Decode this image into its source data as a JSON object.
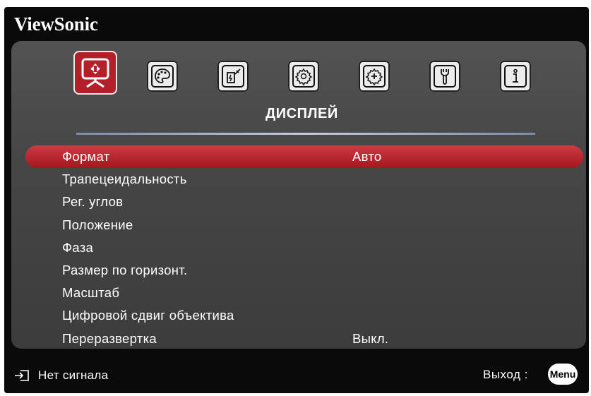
{
  "brand": "ViewSonic",
  "tabs": [
    {
      "name": "display",
      "icon": "display-icon",
      "active": true
    },
    {
      "name": "picture",
      "icon": "palette-icon",
      "active": false
    },
    {
      "name": "power",
      "icon": "power-management-icon",
      "active": false
    },
    {
      "name": "basic",
      "icon": "gear-icon",
      "active": false
    },
    {
      "name": "advanced",
      "icon": "gear-plus-icon",
      "active": false
    },
    {
      "name": "system",
      "icon": "wrench-icon",
      "active": false
    },
    {
      "name": "info",
      "icon": "info-icon",
      "active": false
    }
  ],
  "section_title": "ДИСПЛЕЙ",
  "menu": {
    "items": [
      {
        "label": "Формат",
        "value": "Авто"
      },
      {
        "label": "Трапецеидальность",
        "value": ""
      },
      {
        "label": "Рег. углов",
        "value": ""
      },
      {
        "label": "Положение",
        "value": ""
      },
      {
        "label": "Фаза",
        "value": ""
      },
      {
        "label": "Размер по горизонт.",
        "value": ""
      },
      {
        "label": "Масштаб",
        "value": ""
      },
      {
        "label": "Цифровой сдвиг объектива",
        "value": ""
      },
      {
        "label": "Переразвертка",
        "value": "Выкл."
      }
    ],
    "selected_index": 0
  },
  "footer": {
    "input_icon": "input-source-icon",
    "signal_text": "Нет сигнала",
    "exit_text": "Выход :",
    "menu_button": "Menu"
  },
  "colors": {
    "accent": "#b3202a",
    "panel": "#4a4a4a",
    "background": "#0a0a0a"
  }
}
